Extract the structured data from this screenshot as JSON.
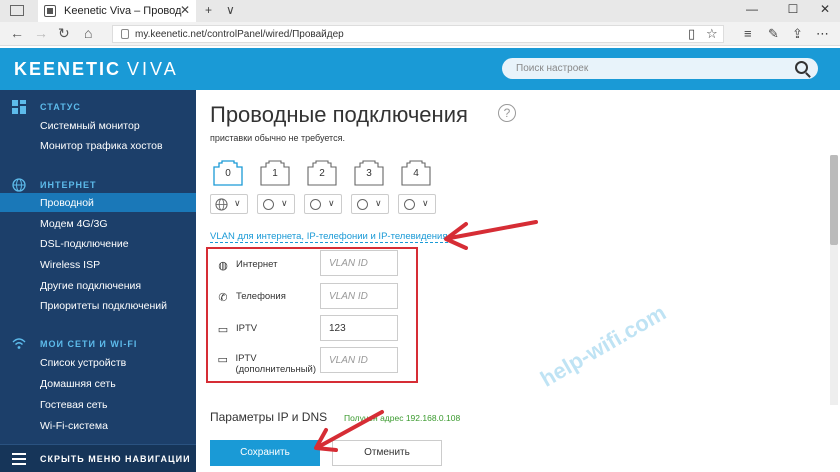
{
  "browser": {
    "tab_title": "Keenetic Viva – Провод",
    "tab_close": "✕",
    "new_tab": "+",
    "tab_menu": "∨",
    "url": "my.keenetic.net/controlPanel/wired/Провайдер",
    "window_min": "—",
    "window_max": "☐",
    "window_close": "✕"
  },
  "header": {
    "brand": "KEENETIC",
    "model": "VIVA",
    "search_placeholder": "Поиск настроек"
  },
  "sidebar": {
    "sections": [
      {
        "title": "СТАТУС",
        "items": [
          "Системный монитор",
          "Монитор трафика хостов"
        ]
      },
      {
        "title": "ИНТЕРНЕТ",
        "items": [
          "Проводной",
          "Модем 4G/3G",
          "DSL-подключение",
          "Wireless ISP",
          "Другие подключения",
          "Приоритеты подключений"
        ]
      },
      {
        "title": "МОИ СЕТИ И WI-FI",
        "items": [
          "Список устройств",
          "Домашняя сеть",
          "Гостевая сеть",
          "Wi-Fi-система"
        ]
      }
    ],
    "active_item": "Проводной",
    "collapse_label": "СКРЫТЬ МЕНЮ НАВИГАЦИИ"
  },
  "main": {
    "title": "Проводные подключения",
    "help": "?",
    "note": "приставки обычно не требуется.",
    "ports": [
      "0",
      "1",
      "2",
      "3",
      "4"
    ],
    "vlan_link": "VLAN для интернета, IP-телефонии и IP-телевидения",
    "vlan_rows": [
      {
        "label": "Интернет",
        "icon": "globe-icon",
        "value": "",
        "placeholder": "VLAN ID"
      },
      {
        "label": "Телефония",
        "icon": "phone-icon",
        "value": "",
        "placeholder": "VLAN ID"
      },
      {
        "label": "IPTV",
        "icon": "tv-icon",
        "value": "123",
        "placeholder": "VLAN ID"
      },
      {
        "label": "IPTV\n(дополнительный)",
        "icon": "tv-icon",
        "value": "",
        "placeholder": "VLAN ID"
      }
    ],
    "ip_title": "Параметры IP и DNS",
    "ip_status": "Получен адрес 192.168.0.108",
    "save_label": "Сохранить",
    "cancel_label": "Отменить"
  },
  "watermark": "help-wifi.com",
  "colors": {
    "header_bg": "#1a9ad6",
    "sidebar_bg": "#1c3f6a",
    "active_item_bg": "#1a78b8",
    "highlight_red": "#d62d35"
  }
}
